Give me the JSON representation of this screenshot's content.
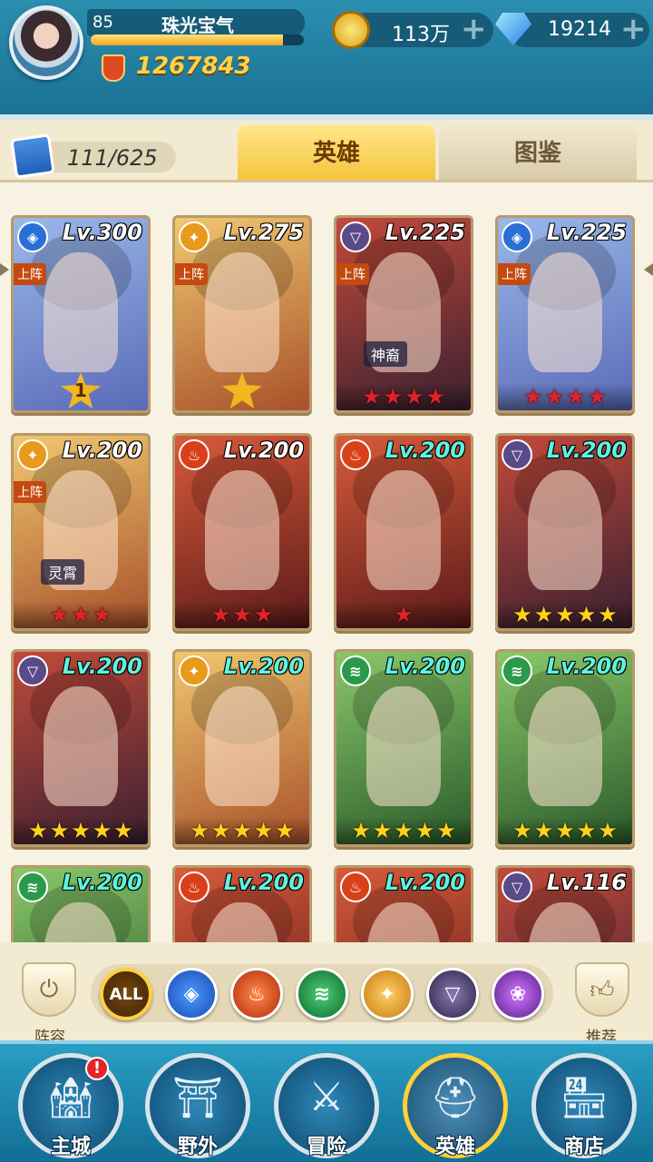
{
  "player": {
    "level": "85",
    "name": "珠光宝气",
    "exp_fraction": 0.9,
    "power": "1267843"
  },
  "resources": {
    "gold": "113万",
    "gems": "19214",
    "add_symbol": "+"
  },
  "hero_count": "111/625",
  "tabs": {
    "heroes": "英雄",
    "codex": "图鉴"
  },
  "heroes": [
    {
      "element": "water",
      "level": "Lv.300",
      "on_team": "上阵",
      "rank": "1",
      "stars": 0,
      "star_color": "gold"
    },
    {
      "element": "light",
      "level": "Lv.275",
      "on_team": "上阵",
      "rank_star": true,
      "stars": 0,
      "star_color": "gold"
    },
    {
      "element": "dark",
      "level": "Lv.225",
      "on_team": "上阵",
      "tag": "神裔",
      "stars": 4,
      "star_color": "red"
    },
    {
      "element": "water",
      "level": "Lv.225",
      "on_team": "上阵",
      "stars": 4,
      "star_color": "red"
    },
    {
      "element": "light",
      "level": "Lv.200",
      "on_team": "上阵",
      "tag": "灵霄",
      "stars": 3,
      "star_color": "red"
    },
    {
      "element": "fire",
      "level": "Lv.200",
      "stars": 3,
      "star_color": "red"
    },
    {
      "element": "fire",
      "level": "Lv.200",
      "level_cyan": true,
      "stars": 1,
      "star_color": "red"
    },
    {
      "element": "dark",
      "level": "Lv.200",
      "level_cyan": true,
      "stars": 5,
      "star_color": "gold"
    },
    {
      "element": "dark",
      "level": "Lv.200",
      "level_cyan": true,
      "stars": 5,
      "star_color": "gold"
    },
    {
      "element": "light",
      "level": "Lv.200",
      "level_cyan": true,
      "stars": 5,
      "star_color": "gold"
    },
    {
      "element": "nature",
      "level": "Lv.200",
      "level_cyan": true,
      "stars": 5,
      "star_color": "gold"
    },
    {
      "element": "nature",
      "level": "Lv.200",
      "level_cyan": true,
      "stars": 5,
      "star_color": "gold"
    },
    {
      "element": "nature",
      "level": "Lv.200",
      "level_cyan": true,
      "stars": 0
    },
    {
      "element": "fire",
      "level": "Lv.200",
      "level_cyan": true,
      "stars": 0
    },
    {
      "element": "fire",
      "level": "Lv.200",
      "level_cyan": true,
      "stars": 0
    },
    {
      "element": "dark",
      "level": "Lv.116",
      "stars": 0
    }
  ],
  "filters": {
    "all": "ALL",
    "lineup_label": "阵容",
    "recommend_label": "推荐"
  },
  "nav": {
    "main_city": "主城",
    "wild": "野外",
    "adventure": "冒险",
    "heroes": "英雄",
    "shop": "商店",
    "alert": "!"
  },
  "colors": {
    "water": "#2a6fd6",
    "light": "#e89a1a",
    "dark": "#5a4a8a",
    "fire": "#d8401a",
    "nature": "#2a9a4a",
    "void": "#9a3ac8"
  }
}
